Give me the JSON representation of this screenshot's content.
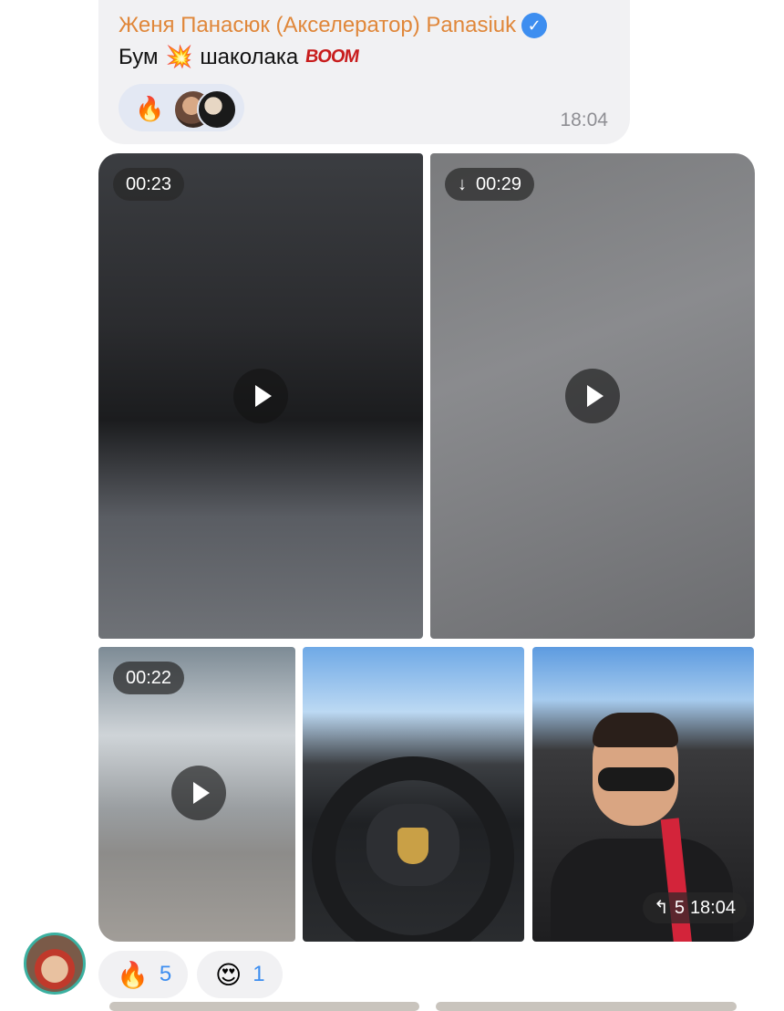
{
  "message": {
    "sender": "Женя Панасюк (Акселератор) Panasiuk",
    "verified_icon": "verified-badge-icon",
    "text": "Бум",
    "emoji_collision": "💥",
    "text2": "шаколака",
    "boom_sticker": "BOOM",
    "reaction": {
      "emoji": "🔥"
    },
    "time": "18:04"
  },
  "album": {
    "videos": [
      {
        "duration": "00:23",
        "downloaded": true
      },
      {
        "duration": "00:29",
        "downloaded": false,
        "download_icon": "↓"
      },
      {
        "duration": "00:22",
        "downloaded": true
      }
    ],
    "footer": {
      "reply_icon": "↰",
      "replies": "5",
      "time": "18:04"
    }
  },
  "reactions": [
    {
      "emoji": "🔥",
      "count": "5"
    },
    {
      "emoji": "😍",
      "count": "1"
    }
  ]
}
